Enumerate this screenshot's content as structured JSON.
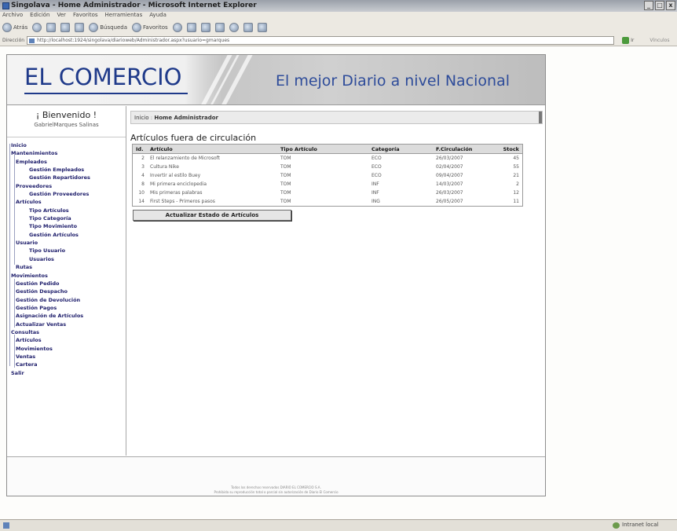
{
  "window": {
    "title": "Singolava - Home Administrador - Microsoft Internet Explorer",
    "controls": [
      "_",
      "□",
      "x"
    ]
  },
  "menubar": [
    "Archivo",
    "Edición",
    "Ver",
    "Favoritos",
    "Herramientas",
    "Ayuda"
  ],
  "toolbar": {
    "back_label": "Atrás",
    "search_label": "Búsqueda",
    "favorites_label": "Favoritos"
  },
  "address": {
    "label": "Dirección",
    "url": "http://localhost:1924/singolava/diarioweb/Administrador.aspx?usuario=gmarques",
    "go_label": "Ir",
    "links_label": "Vínculos"
  },
  "banner": {
    "logo": "EL COMERCIO",
    "tagline": "El mejor Diario a nivel Nacional"
  },
  "sidebar": {
    "welcome": "¡ Bienvenido !",
    "user": "GabrielMarques Salinas",
    "items": [
      {
        "label": "Inicio",
        "level": 0
      },
      {
        "label": "Mantenimientos",
        "level": 0
      },
      {
        "label": "Empleados",
        "level": 1
      },
      {
        "label": "Gestión Empleados",
        "level": 2
      },
      {
        "label": "Gestión Repartidores",
        "level": 2
      },
      {
        "label": "Proveedores",
        "level": 1
      },
      {
        "label": "Gestión Proveedores",
        "level": 2
      },
      {
        "label": "Artículos",
        "level": 1
      },
      {
        "label": "Tipo Artículos",
        "level": 2
      },
      {
        "label": "Tipo Categoría",
        "level": 2
      },
      {
        "label": "Tipo Movimiento",
        "level": 2
      },
      {
        "label": "Gestión Artículos",
        "level": 2
      },
      {
        "label": "Usuario",
        "level": 1
      },
      {
        "label": "Tipo Usuario",
        "level": 2
      },
      {
        "label": "Usuarios",
        "level": 2
      },
      {
        "label": "Rutas",
        "level": 1
      },
      {
        "label": "Movimientos",
        "level": 0
      },
      {
        "label": "Gestión Pedido",
        "level": 1
      },
      {
        "label": "Gestión Despacho",
        "level": 1
      },
      {
        "label": "Gestión de Devolución",
        "level": 1
      },
      {
        "label": "Gestión Pagos",
        "level": 1
      },
      {
        "label": "Asignación de Artículos",
        "level": 1
      },
      {
        "label": "Actualizar Ventas",
        "level": 1
      },
      {
        "label": "Consultas",
        "level": 0
      },
      {
        "label": "Artículos",
        "level": 1
      },
      {
        "label": "Movimientos",
        "level": 1
      },
      {
        "label": "Ventas",
        "level": 1
      },
      {
        "label": "Cartera",
        "level": 1
      },
      {
        "label": "Salir",
        "level": 0
      }
    ]
  },
  "main": {
    "breadcrumb_root": "Inicio",
    "breadcrumb_sep": ":",
    "breadcrumb_current": "Home Administrador",
    "section_title": "Artículos fuera de circulación",
    "table": {
      "headers": [
        "Id.",
        "Artículo",
        "Tipo Artículo",
        "Categoría",
        "F.Circulación",
        "Stock"
      ],
      "rows": [
        [
          "2",
          "El relanzamiento de Microsoft",
          "TOM",
          "ECO",
          "26/03/2007",
          "45"
        ],
        [
          "3",
          "Cultura Nike",
          "TOM",
          "ECO",
          "02/04/2007",
          "55"
        ],
        [
          "4",
          "Invertir al estilo Buey",
          "TOM",
          "ECO",
          "09/04/2007",
          "21"
        ],
        [
          "8",
          "Mi primera enciclopedia",
          "TOM",
          "INF",
          "14/03/2007",
          "2"
        ],
        [
          "10",
          "Mis primeras palabras",
          "TOM",
          "INF",
          "26/03/2007",
          "12"
        ],
        [
          "14",
          "First Steps - Primeros pasos",
          "TOM",
          "ING",
          "26/05/2007",
          "11"
        ]
      ]
    },
    "update_button": "Actualizar Estado de Artículos"
  },
  "footer": {
    "line1": "Todos los derechos reservados DIARIO EL COMERCIO S.A.",
    "line2": "Prohibida su reproducción total o parcial sin autorización de Diario El Comercio"
  },
  "statusbar": {
    "zone": "Intranet local"
  }
}
